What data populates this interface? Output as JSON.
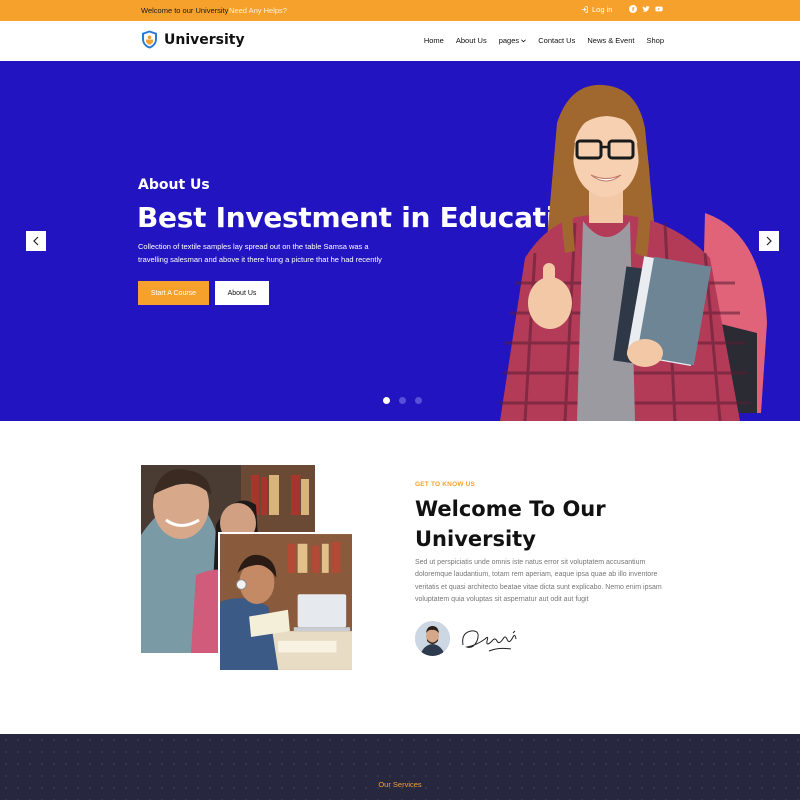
{
  "topbar": {
    "welcome": "Welcome to our University",
    "help": "Need Any Helps?",
    "login": "Log in",
    "socials": [
      "facebook-icon",
      "twitter-icon",
      "youtube-icon"
    ]
  },
  "nav": {
    "brand": "University",
    "items": [
      {
        "label": "Home"
      },
      {
        "label": "About Us"
      },
      {
        "label": "pages"
      },
      {
        "label": "Contact Us"
      },
      {
        "label": "News & Event"
      },
      {
        "label": "Shop"
      }
    ]
  },
  "hero": {
    "kicker": "About Us",
    "title": "Best Investment in Education",
    "description": "Collection of textile samples lay spread out on the table Samsa was a travelling salesman and above it there hung a picture that he had recently",
    "primary_button": "Start A Course",
    "secondary_button": "About Us",
    "slides": 3,
    "active_slide": 1
  },
  "about": {
    "eyebrow": "GET TO KNOW US",
    "title": "Welcome To Our University",
    "body": "Sed ut perspiciatis unde omnis iste natus error sit voluptatem accusantium doloremque laudantium, totam rem aperiam, eaque ipsa quae ab illo inventore veritatis et quasi architecto beatae vitae dicta sunt explicabo. Nemo enim ipsam voluptatem quia voluptas sit aspernatur aut odit aut fugit"
  },
  "services": {
    "label": "Our Services"
  },
  "colors": {
    "accent": "#f7a12d",
    "hero_bg": "#2314c1",
    "dark_bg": "#27273f"
  }
}
